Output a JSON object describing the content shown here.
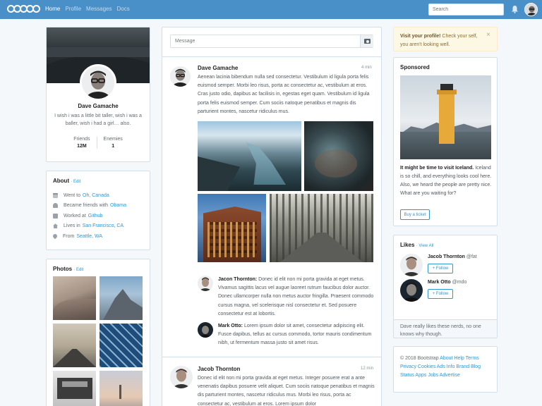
{
  "nav": {
    "links": [
      "Home",
      "Profile",
      "Messages",
      "Docs"
    ],
    "search_placeholder": "Search"
  },
  "profile": {
    "name": "Dave Gamache",
    "bio": "I wish i was a little bit taller, wish i was a baller, wish i had a girl… also.",
    "friends_label": "Friends",
    "friends_value": "12M",
    "enemies_label": "Enemies",
    "enemies_value": "1"
  },
  "about": {
    "title": "About",
    "edit": "· Edit",
    "items": [
      {
        "icon": "calendar-icon",
        "text": "Went to",
        "link": "Oh, Canada"
      },
      {
        "icon": "users-icon",
        "text": "Became friends with",
        "link": "Obama"
      },
      {
        "icon": "briefcase-icon",
        "text": "Worked at",
        "link": "Github"
      },
      {
        "icon": "home-icon",
        "text": "Lives in",
        "link": "San Francisco, CA"
      },
      {
        "icon": "location-icon",
        "text": "From",
        "link": "Seattle, WA"
      }
    ]
  },
  "photos": {
    "title": "Photos",
    "edit": "· Edit"
  },
  "composer": {
    "placeholder": "Message"
  },
  "posts": [
    {
      "author": "Dave Gamache",
      "time": "4 min",
      "text": "Aenean lacinia bibendum nulla sed consectetur. Vestibulum id ligula porta felis euismod semper. Morbi leo risus, porta ac consectetur ac, vestibulum at eros. Cras justo odio, dapibus ac facilisis in, egestas eget quam. Vestibulum id ligula porta felis euismod semper. Cum sociis natoque penatibus et magnis dis parturient montes, nascetur ridiculus mus.",
      "comments": [
        {
          "author": "Jacon Thornton:",
          "text": "Donec id elit non mi porta gravida at eget metus. Vivamus sagittis lacus vel augue laoreet rutrum faucibus dolor auctor. Donec ullamcorper nulla non metus auctor fringilla. Praesent commodo cursus magna, vel scelerisque nisl consectetur et. Sed posuere consectetur est at lobortis."
        },
        {
          "author": "Mark Otto:",
          "text": "Lorem ipsum dolor sit amet, consectetur adipiscing elit. Fusce dapibus, tellus ac cursus commodo, tortor mauris condimentum nibh, ut fermentum massa justo sit amet risus."
        }
      ]
    },
    {
      "author": "Jacob Thornton",
      "time": "12 min",
      "text": "Donec id elit non mi porta gravida at eget metus. Integer posuere erat a ante venenatis dapibus posuere velit aliquet. Cum sociis natoque penatibus et magnis dis parturient montes, nascetur ridiculus mus. Morbi leo risus, porta ac consectetur ac, vestibulum at eros. Lorem ipsum dolor"
    }
  ],
  "alert": {
    "strong": "Visit your profile!",
    "text": " Check your self, you aren't looking well.",
    "close": "×"
  },
  "sponsored": {
    "title": "Sponsored",
    "headline": "It might be time to visit Iceland.",
    "text": " Iceland is so chill, and everything looks cool here. Also, we heard the people are pretty nice. What are you waiting for?",
    "button": "Buy a ticket"
  },
  "likes": {
    "title": "Likes",
    "view_all": "· View All",
    "people": [
      {
        "name": "Jacob Thornton",
        "handle": "@fat",
        "button": "Follow"
      },
      {
        "name": "Mark Otto",
        "handle": "@mdo",
        "button": "Follow"
      }
    ],
    "footer": "Dave really likes these nerds, no one knows why though."
  },
  "footer": {
    "copyright": "© 2018 Bootstrap",
    "links": [
      "About",
      "Help",
      "Terms",
      "Privacy",
      "Cookies",
      "Ads",
      "Info",
      "Brand",
      "Blog",
      "Status",
      "Apps",
      "Jobs",
      "Advertise"
    ]
  }
}
